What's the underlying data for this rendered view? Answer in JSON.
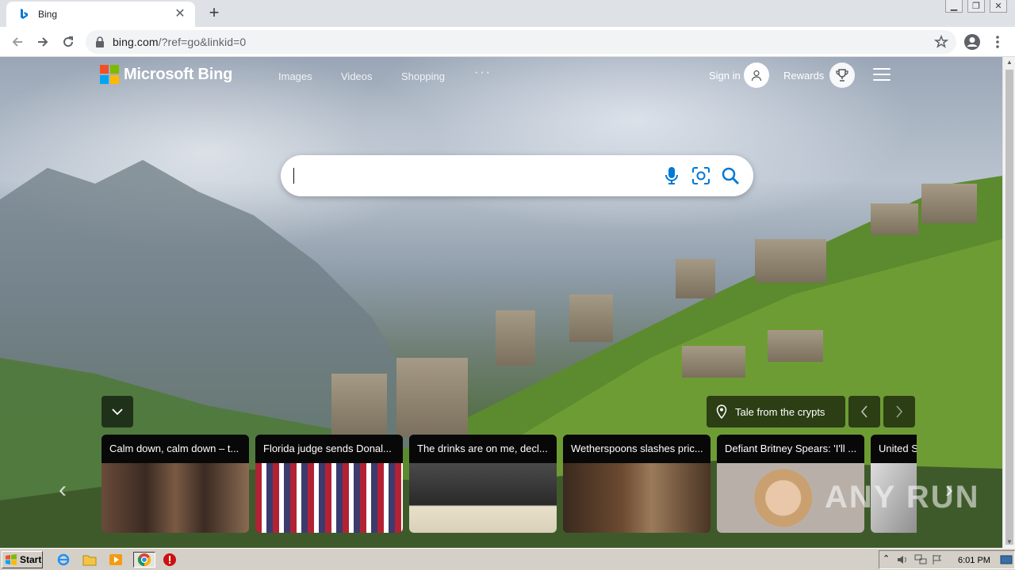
{
  "browser": {
    "tab_title": "Bing",
    "new_tab_label": "+",
    "url_host": "bing.com",
    "url_path": "/?ref=go&linkid=0"
  },
  "bing": {
    "brand": "Microsoft Bing",
    "nav": [
      "Images",
      "Videos",
      "Shopping"
    ],
    "more": "···",
    "sign_in": "Sign in",
    "rewards": "Rewards",
    "search_value": "",
    "location_caption": "Tale from the crypts"
  },
  "news": [
    {
      "title": "Calm down, calm down – t..."
    },
    {
      "title": "Florida judge sends Donal..."
    },
    {
      "title": "The drinks are on me, decl..."
    },
    {
      "title": "Wetherspoons slashes pric..."
    },
    {
      "title": "Defiant Britney Spears: 'I'll ..."
    },
    {
      "title": "United S"
    }
  ],
  "watermark": "ANY RUN",
  "taskbar": {
    "start_label": "Start",
    "clock": "6:01 PM"
  },
  "colors": {
    "ms_red": "#f25022",
    "ms_green": "#7fba00",
    "ms_blue": "#00a4ef",
    "ms_yellow": "#ffb900",
    "bing_blue": "#0078d4"
  }
}
